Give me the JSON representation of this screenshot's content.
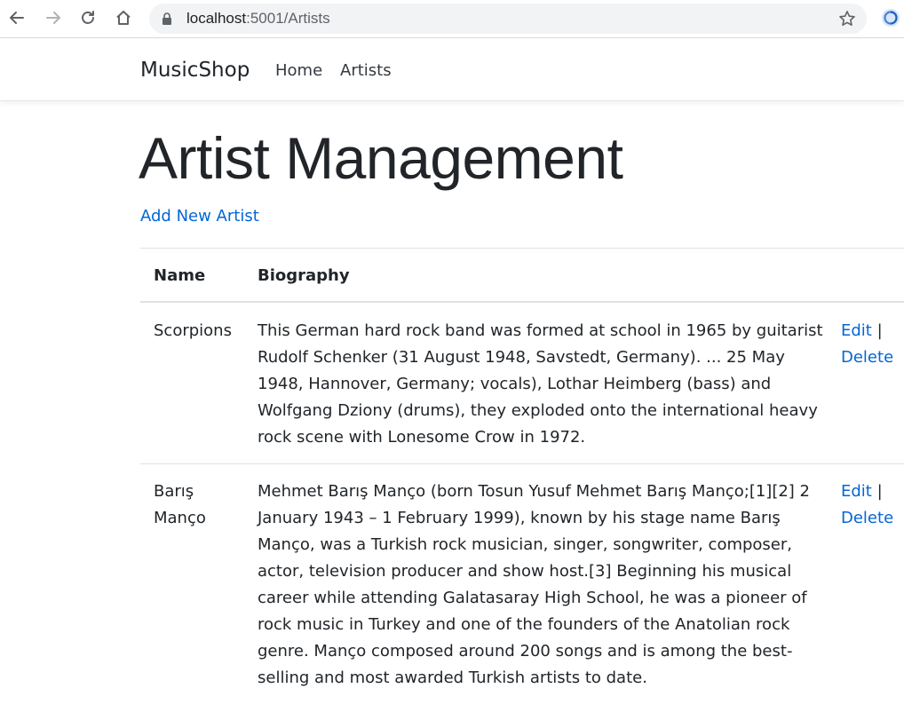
{
  "browser": {
    "url_host": "localhost",
    "url_path": ":5001/Artists"
  },
  "navbar": {
    "brand": "MusicShop",
    "links": [
      "Home",
      "Artists"
    ]
  },
  "page": {
    "title": "Artist Management",
    "add_link": "Add New Artist"
  },
  "table": {
    "headers": [
      "Name",
      "Biography"
    ],
    "rows": [
      {
        "name": "Scorpions",
        "biography": "This German hard rock band was formed at school in 1965 by guitarist Rudolf Schenker (31 August 1948, Savstedt, Germany). ... 25 May 1948, Hannover, Germany; vocals), Lothar Heimberg (bass) and Wolfgang Dziony (drums), they exploded onto the international heavy rock scene with Lonesome Crow in 1972.",
        "edit": "Edit",
        "separator": " |",
        "delete": "Delete"
      },
      {
        "name": "Barış Manço",
        "biography": "Mehmet Barış Manço (born Tosun Yusuf Mehmet Barış Manço;[1][2] 2 January 1943 – 1 February 1999), known by his stage name Barış Manço, was a Turkish rock musician, singer, songwriter, composer, actor, television producer and show host.[3] Beginning his musical career while attending Galatasaray High School, he was a pioneer of rock music in Turkey and one of the founders of the Anatolian rock genre. Manço composed around 200 songs and is among the best-selling and most awarded Turkish artists to date.",
        "edit": "Edit",
        "separator": " |",
        "delete": "Delete"
      }
    ]
  },
  "colors": {
    "link": "#0366d6",
    "text": "#212529",
    "border": "#dee2e6"
  }
}
